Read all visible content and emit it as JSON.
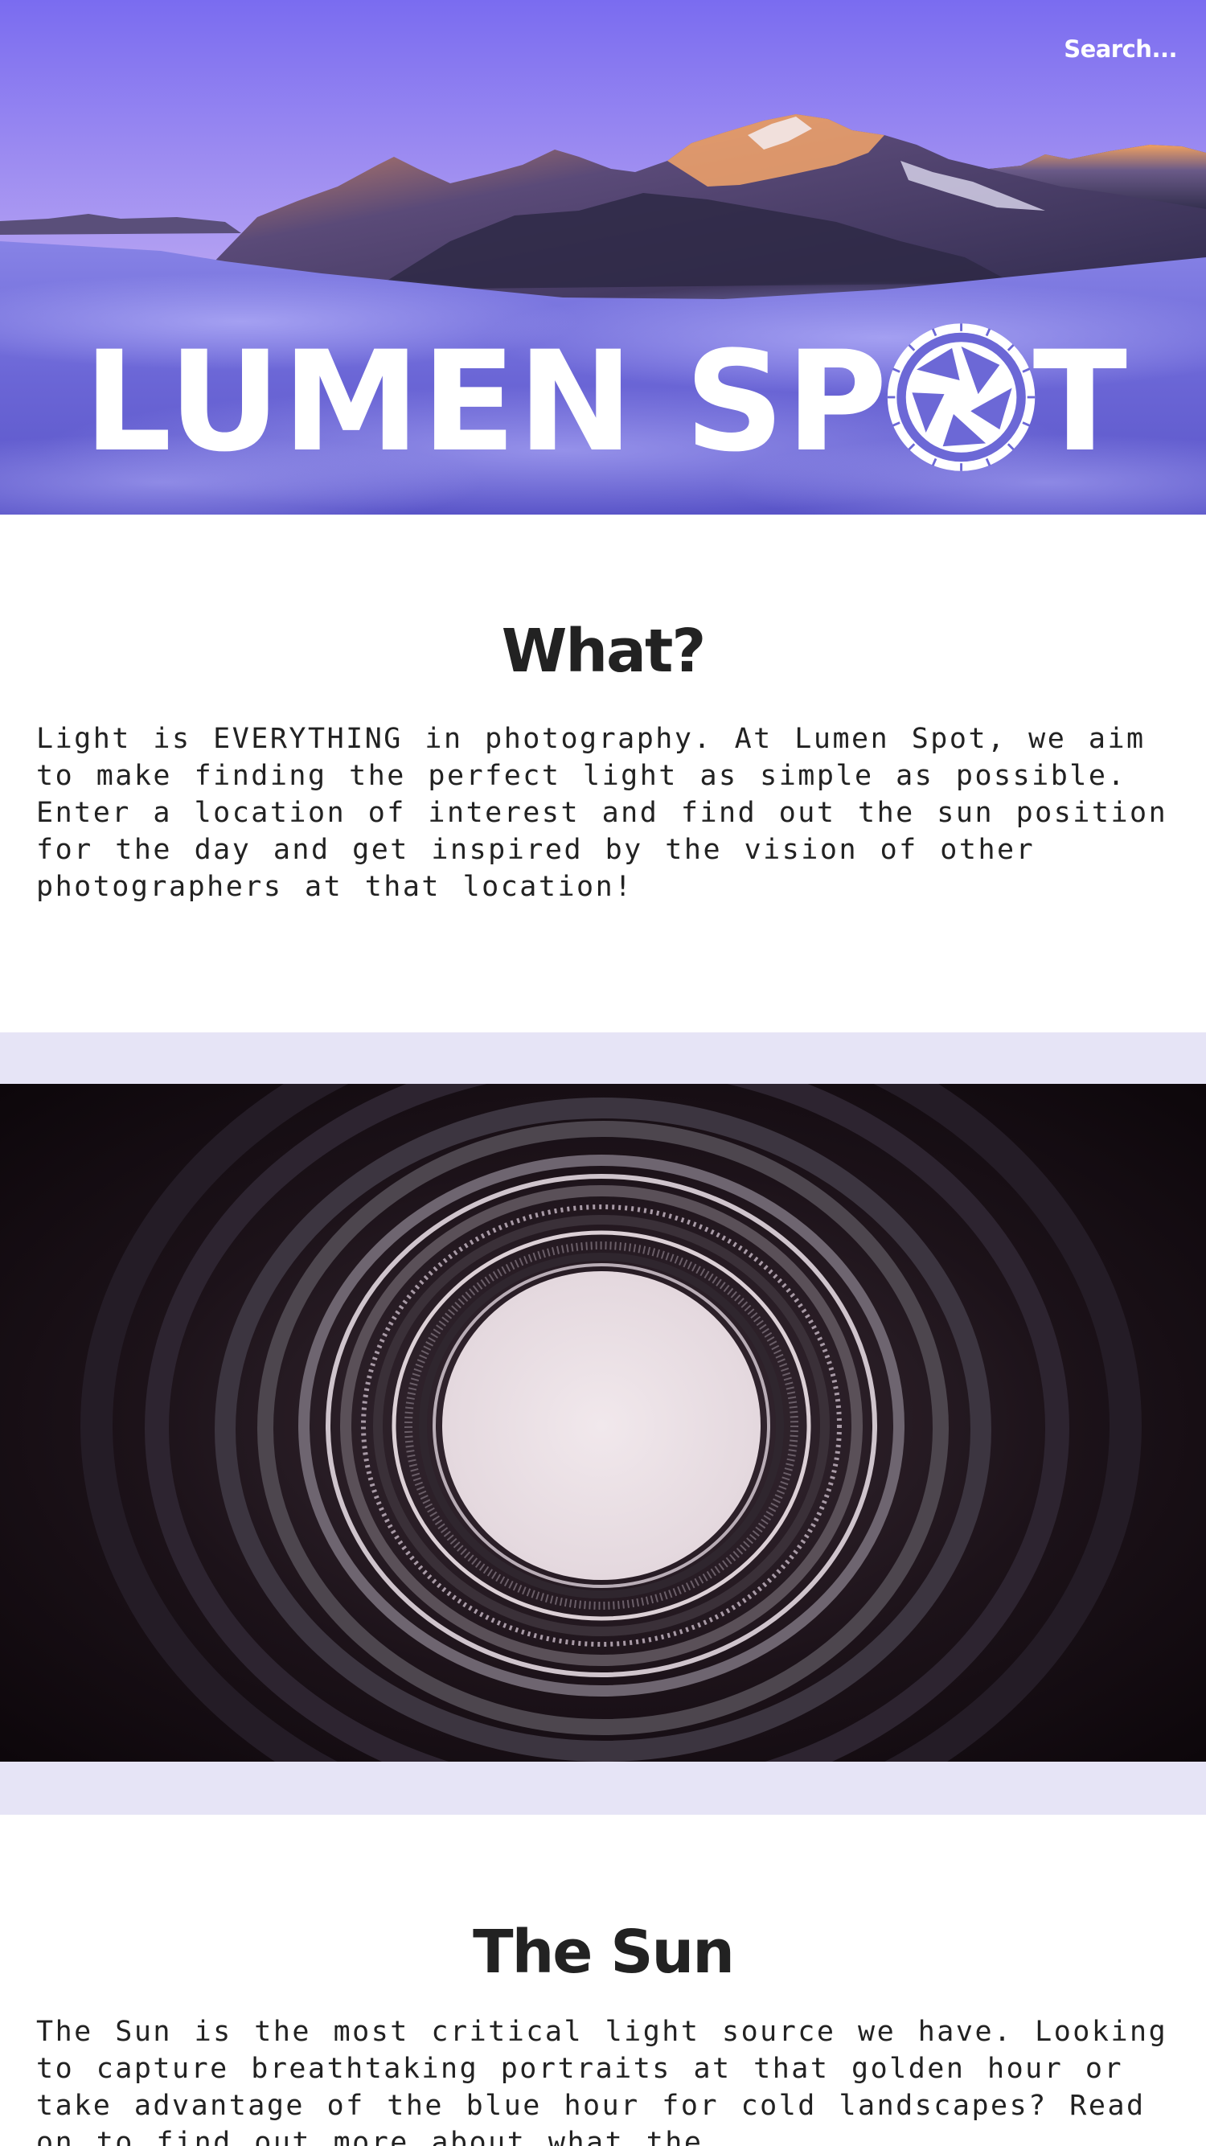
{
  "header": {
    "search_label": "Search..."
  },
  "logo": {
    "text_left": "LUMEN SP",
    "text_right": "T",
    "icon": "aperture-icon"
  },
  "sections": {
    "what": {
      "heading": "What?",
      "body": "Light is EVERYTHING in photography. At Lumen Spot, we aim to make finding the perfect light as simple as possible. Enter a location of interest and find out the sun position for the day and get inspired by the vision of other photographers at that location!"
    },
    "sun": {
      "heading": "The Sun",
      "body": "The Sun is the most critical light source we have. Looking to capture breathtaking portraits at that golden hour or take advantage of the blue hour for cold landscapes? Read on to find out more about what the"
    }
  },
  "colors": {
    "hero_sky_top": "#7a6cf0",
    "hero_sky_mid": "#b8a6f0",
    "hero_horizon": "#f0a98a",
    "clouds": "#6d68d8",
    "band": "#e6e4f6",
    "text": "#222222"
  }
}
